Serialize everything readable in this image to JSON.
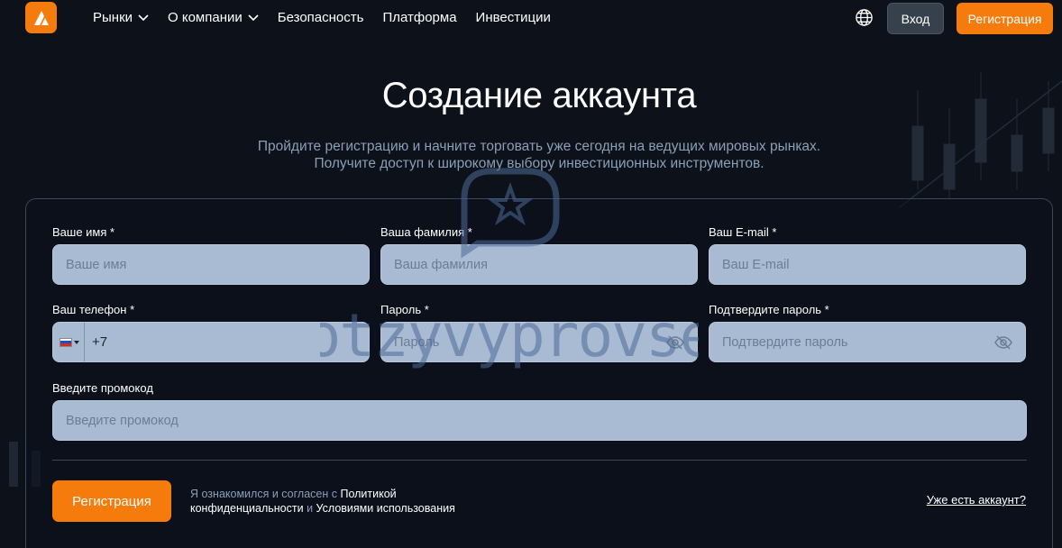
{
  "header": {
    "nav": [
      {
        "label": "Рынки",
        "has_dropdown": true
      },
      {
        "label": "О компании",
        "has_dropdown": true
      },
      {
        "label": "Безопасность",
        "has_dropdown": false
      },
      {
        "label": "Платформа",
        "has_dropdown": false
      },
      {
        "label": "Инвестиции",
        "has_dropdown": false
      }
    ],
    "login_label": "Вход",
    "register_label": "Регистрация"
  },
  "page": {
    "title": "Создание аккаунта",
    "subtitle_line1": "Пройдите регистрацию и начните торговать уже сегодня на ведущих мировых рынках.",
    "subtitle_line2": "Получите доступ к широкому выбору инвестиционных инструментов."
  },
  "form": {
    "first_name": {
      "label": "Ваше имя *",
      "placeholder": "Ваше имя"
    },
    "last_name": {
      "label": "Ваша фамилия *",
      "placeholder": "Ваша фамилия"
    },
    "email": {
      "label": "Ваш E-mail *",
      "placeholder": "Ваш E-mail"
    },
    "phone": {
      "label": "Ваш телефон *",
      "value": "+7",
      "country": "RU"
    },
    "password": {
      "label": "Пароль *",
      "placeholder": "Пароль"
    },
    "confirm_password": {
      "label": "Подтвердите пароль *",
      "placeholder": "Подтвердите пароль"
    },
    "promo": {
      "label": "Введите промокод",
      "placeholder": "Введите промокод"
    },
    "submit_label": "Регистрация",
    "agree_prefix": "Я ознакомился и согласен с",
    "agree_policy": "Политикой конфиденциальности",
    "agree_and": "и",
    "agree_terms": "Условиями использования",
    "have_account": "Уже есть аккаунт?"
  },
  "watermark": {
    "text": "otzyvyprovse"
  },
  "colors": {
    "accent": "#f57c0c",
    "background": "#0c111a",
    "input_bg": "#a9bbd3",
    "muted_text": "#8a9fb8"
  }
}
